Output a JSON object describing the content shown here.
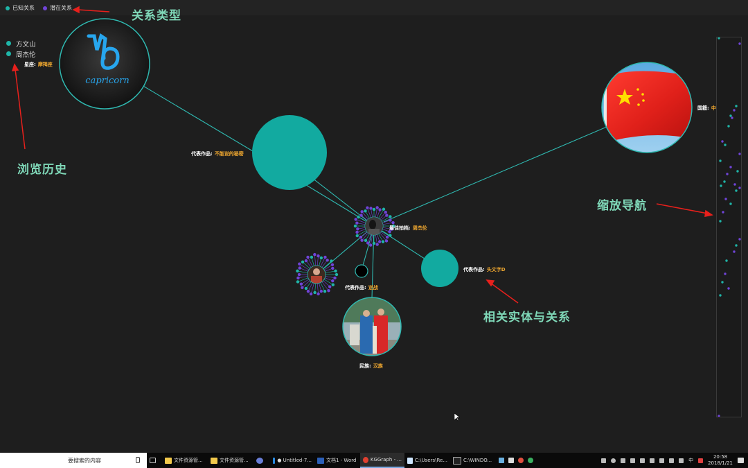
{
  "legend": {
    "known_label": "已知关系",
    "potential_label": "潜在关系",
    "known_color": "#1fb5a8",
    "potential_color": "#7044d8"
  },
  "history": {
    "items": [
      "方文山",
      "周杰伦"
    ]
  },
  "annotations": {
    "relation_types": "关系类型",
    "browse_history": "浏览历史",
    "zoom_nav": "缩放导航",
    "related_entities": "相关实体与关系"
  },
  "graph": {
    "capricorn_text": "capricorn",
    "nodes": {
      "constellation": {
        "key": "星座:",
        "value": "摩羯座"
      },
      "work_secret": {
        "key": "代表作品:",
        "value": "不能说的秘密"
      },
      "nationality": {
        "key": "国籍:",
        "value": "中国"
      },
      "partner": {
        "key": "最佳拍档:",
        "value": "周杰伦"
      },
      "work_initiald": {
        "key": "代表作品:",
        "value": "头文字D"
      },
      "work_nijian": {
        "key": "代表作品:",
        "value": "逆战"
      },
      "ethnicity": {
        "key": "民族:",
        "value": "汉族"
      }
    },
    "colors": {
      "teal": "#1fb5a8",
      "purple": "#7044d8",
      "value_orange": "#f0a830",
      "edge": "#2fb8b0"
    }
  },
  "taskbar": {
    "search_placeholder": "要搜索的内容",
    "apps": [
      {
        "label": "文件资源管...",
        "icon": "folder-icon"
      },
      {
        "label": "文件资源管...",
        "icon": "folder-icon"
      },
      {
        "label": "",
        "icon": "globe-icon"
      },
      {
        "label": "● Untitled-7...",
        "icon": "vscode-icon"
      },
      {
        "label": "文档1 - Word",
        "icon": "word-icon"
      },
      {
        "label": "KGGraph - ...",
        "icon": "chrome-icon"
      },
      {
        "label": "C:\\Users\\Re...",
        "icon": "notepad-icon"
      },
      {
        "label": "C:\\WINDO...",
        "icon": "cmd-icon"
      }
    ],
    "time": "20:58",
    "date": "2018/1/21",
    "ime": "中"
  }
}
